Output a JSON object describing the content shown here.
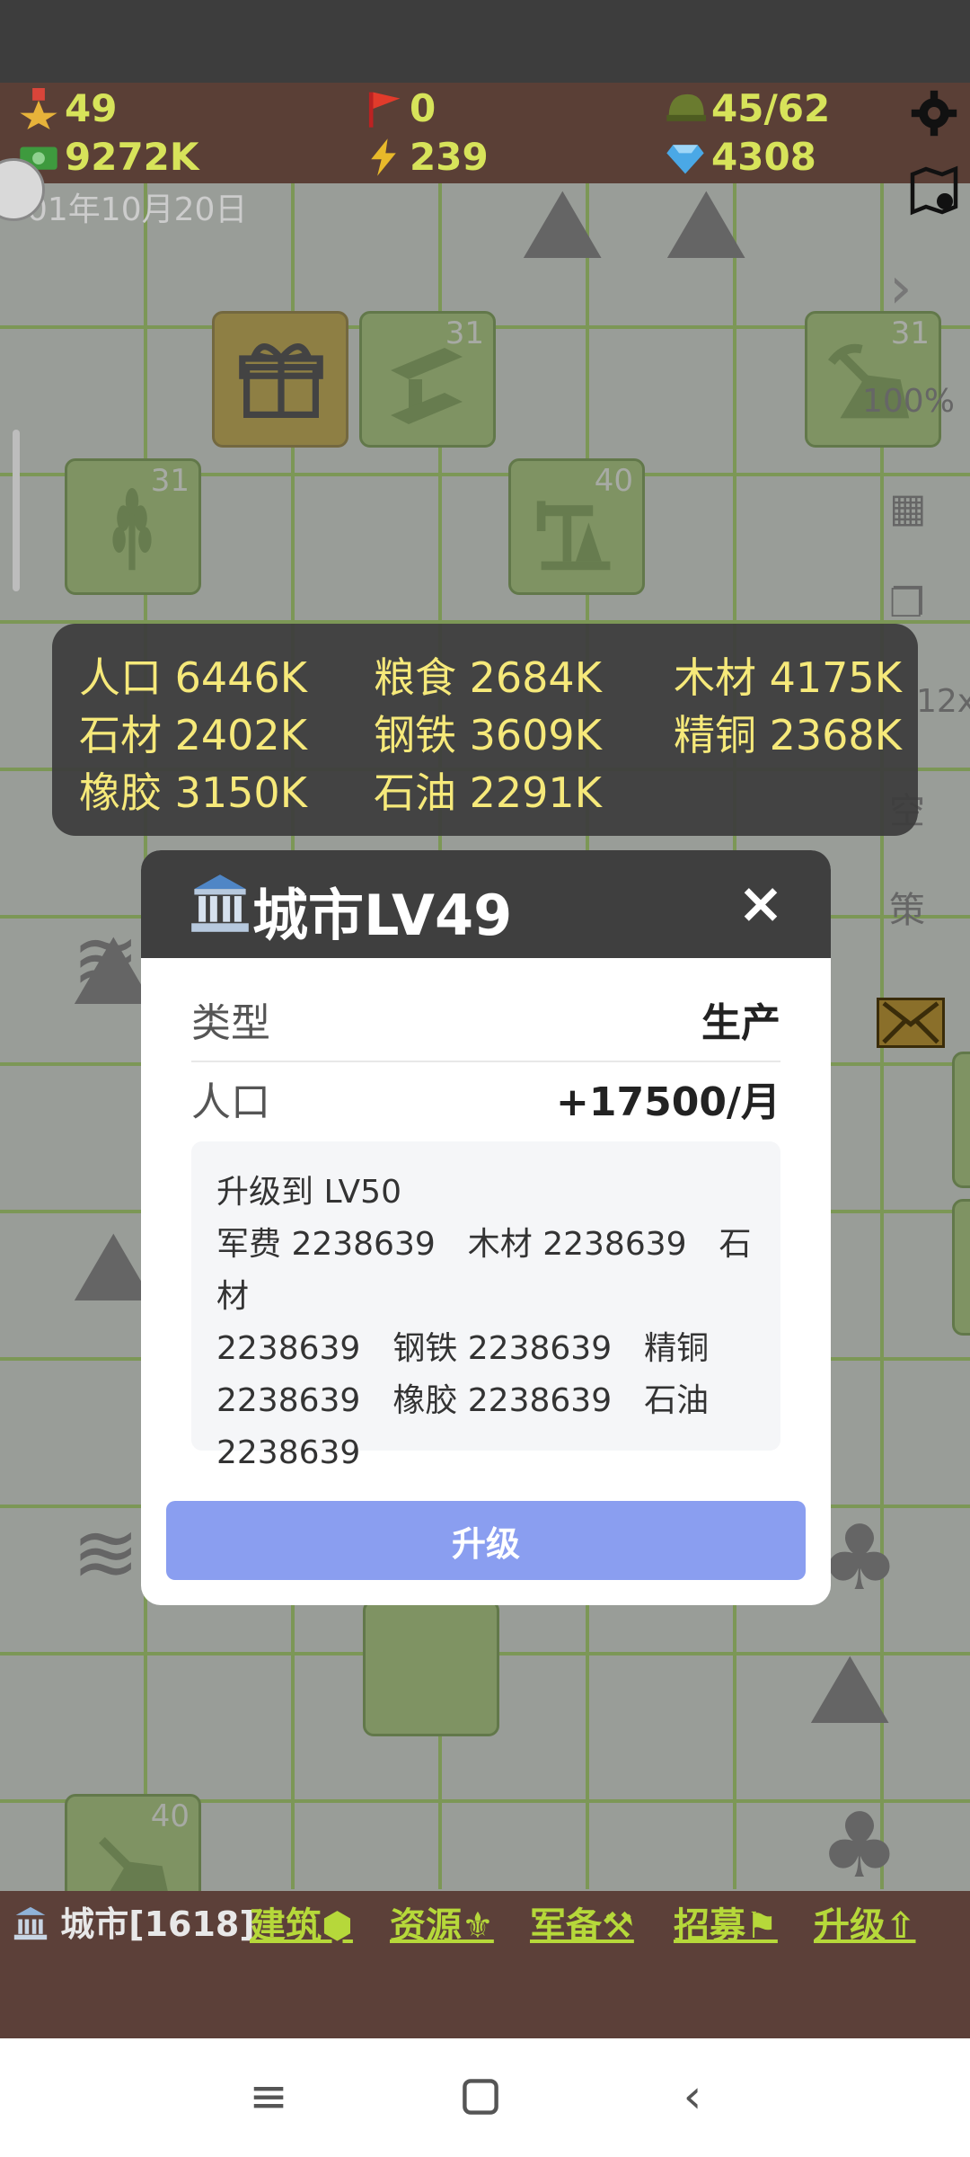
{
  "stats": {
    "medal": "49",
    "flag": "0",
    "helmet": "45/62",
    "money": "9272K",
    "energy": "239",
    "gem": "4308"
  },
  "date": "01年10月20日",
  "tile_levels": {
    "steel": "31",
    "mine": "31",
    "farm": "31",
    "oil": "40",
    "quarry": "40"
  },
  "side": {
    "zoom": "100%",
    "speed": "12x",
    "empty": "空",
    "policy": "策"
  },
  "resources": [
    {
      "label": "人口 6446K"
    },
    {
      "label": "粮食 2684K"
    },
    {
      "label": "木材 4175K"
    },
    {
      "label": "石材 2402K"
    },
    {
      "label": "钢铁 3609K"
    },
    {
      "label": "精铜 2368K"
    },
    {
      "label": "橡胶 3150K"
    },
    {
      "label": "石油 2291K"
    }
  ],
  "modal": {
    "title": "城市LV49",
    "close": "×",
    "type_label": "类型",
    "type_value": "生产",
    "pop_label": "人口",
    "pop_value": "+17500/月",
    "upgrade_line1": "升级到 LV50",
    "upgrade_line2": "军费 2238639　木材 2238639　石材",
    "upgrade_line3": "2238639　钢铁 2238639　精铜",
    "upgrade_line4": "2238639　橡胶 2238639　石油",
    "upgrade_line5": "2238639",
    "upgrade_button": "升级"
  },
  "bottom": {
    "city": "城市[1618]",
    "build": "建筑⬢",
    "resource": "资源⚜",
    "military": "军备⚒",
    "recruit": "招募⚑",
    "upgrade": "升级⇧"
  },
  "colors": {
    "accent": "#8a9ef0",
    "topbar": "#5a3f36",
    "stat_text": "#d7e35a",
    "tile_green": "#95c158"
  }
}
